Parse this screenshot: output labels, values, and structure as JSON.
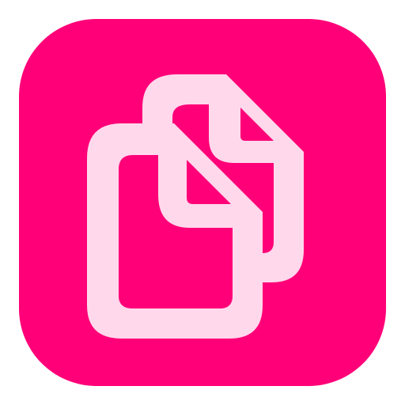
{
  "icon": {
    "name": "copy-files-icon",
    "background_color": "#ff0078",
    "glyph_color": "#ffd8ec"
  }
}
